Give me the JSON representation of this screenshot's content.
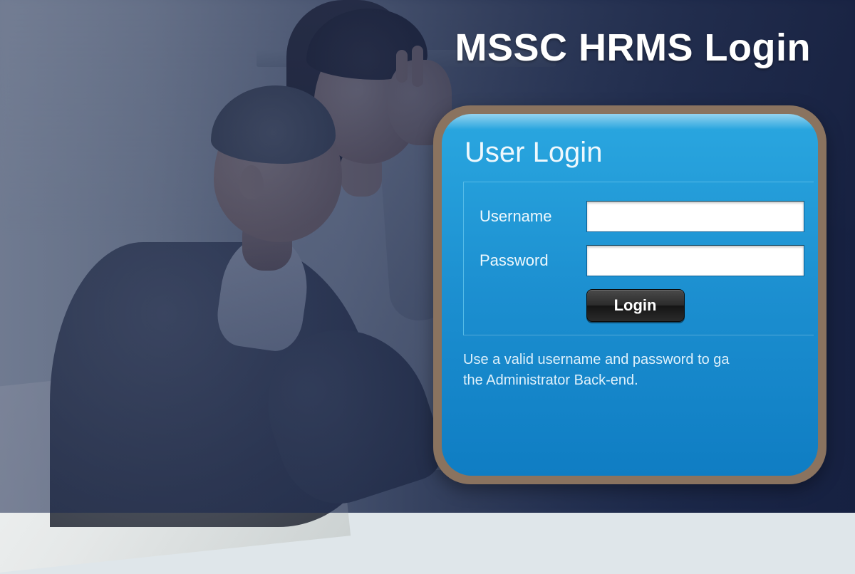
{
  "page": {
    "title": "MSSC HRMS Login"
  },
  "login": {
    "heading": "User Login",
    "username": {
      "label": "Username",
      "value": "",
      "placeholder": ""
    },
    "password": {
      "label": "Password",
      "value": "",
      "placeholder": ""
    },
    "button_label": "Login",
    "helper_text": "Use a valid username and password to ga\nthe Administrator Back-end."
  },
  "colors": {
    "overlay_navy": "#1a284e",
    "card_border": "#8a735f",
    "panel_blue_top": "#2aa7e0",
    "panel_blue_bottom": "#0f7dc3",
    "button_dark": "#2c2c2c"
  }
}
